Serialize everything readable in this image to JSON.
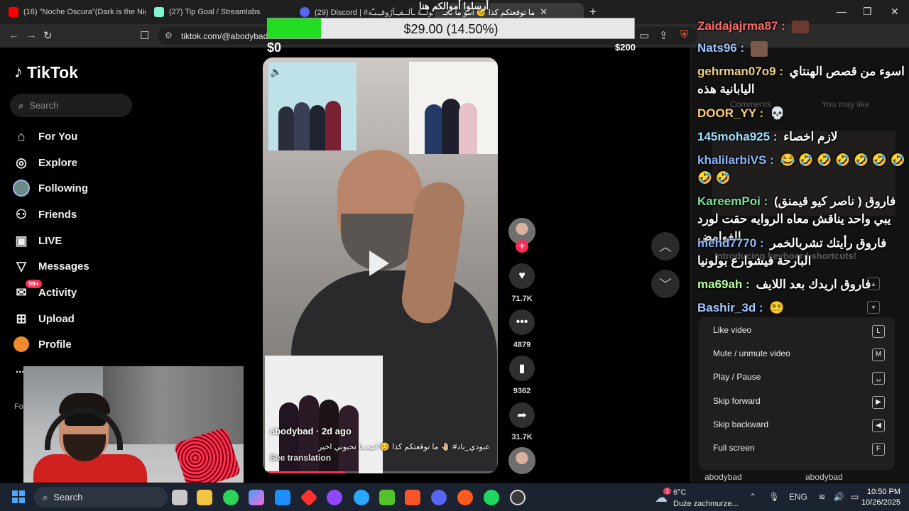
{
  "browser": {
    "tabs": [
      {
        "title": "(16) \"Noche Oscura\"(Dark is the Nigh",
        "favicon_color": "#ff0000"
      },
      {
        "title": "(27) Tip Goal / Streamlabs",
        "favicon_color": "#80f5d2"
      },
      {
        "title": "(29) Discord | #ـقـُولــهٌ ـآلــفـِـآرُوقـِـيـّة",
        "favicon_color": "#5865f2"
      },
      {
        "title": "ما توقعتكم كذا 😊 انتو ما تحـ",
        "favicon_color": "#000000",
        "active": true
      }
    ],
    "url": "tiktok.com/@abodybad"
  },
  "tip_goal": {
    "goal_title": "أرسلوا أموالكم هنا",
    "amount_text": "$29.00 (14.50%)",
    "percent": 14.5,
    "min_label": "$0",
    "max_label": "$200",
    "fill_color": "#22dd22"
  },
  "tiktok": {
    "brand": "TikTok",
    "search_placeholder": "Search",
    "nav": [
      {
        "label": "For You",
        "icon": "home-icon"
      },
      {
        "label": "Explore",
        "icon": "compass-icon"
      },
      {
        "label": "Following",
        "icon": "following-avatar-icon"
      },
      {
        "label": "Friends",
        "icon": "friends-icon"
      },
      {
        "label": "LIVE",
        "icon": "live-icon"
      },
      {
        "label": "Messages",
        "icon": "messages-icon"
      },
      {
        "label": "Activity",
        "icon": "activity-icon",
        "badge": "99+"
      },
      {
        "label": "Upload",
        "icon": "upload-icon"
      },
      {
        "label": "Profile",
        "icon": "profile-icon"
      }
    ],
    "more_label": "...",
    "fo_label": "Fo",
    "accent": "#fe2c55"
  },
  "video": {
    "author_line": "abodybad · 2d ago",
    "caption": "عبودي_باد# 🤚🏼 ما توقعتكم كذا 😊 انتو ما تحبوني اخير",
    "see_translation": "See translation",
    "progress": 0.35
  },
  "actions": {
    "likes": "71.7K",
    "comments": "4879",
    "bookmarks": "9362",
    "shares": "31.7K"
  },
  "panel": {
    "comments_tab": "Comments",
    "you_may_like_tab": "You may like",
    "shortcuts_title": "Introducing keyboard shortcuts!",
    "shortcuts": [
      {
        "label": "Like video",
        "key": "L"
      },
      {
        "label": "Mute / unmute video",
        "key": "M"
      },
      {
        "label": "Play / Pause",
        "key": "␣"
      },
      {
        "label": "Skip forward",
        "key": "▶"
      },
      {
        "label": "Skip backward",
        "key": "◀"
      },
      {
        "label": "Full screen",
        "key": "F"
      }
    ],
    "authors": [
      "abodybad",
      "abodybad"
    ]
  },
  "chat": [
    {
      "user": "Zaidajajrma87 :",
      "message": "",
      "color": "#ff6b6b"
    },
    {
      "user": "Nats96 :",
      "message": "",
      "color": "#9fc8ff"
    },
    {
      "user": "gehrman07o9 :",
      "message": "اسوء من قصص الهنتاي اليابانية هذه",
      "color": "#f0d28a"
    },
    {
      "user": "DOOR_YY :",
      "message": "💀",
      "color": "#ffd27a"
    },
    {
      "user": "145moha925 :",
      "message": "لازم اخصاء",
      "color": "#9fe0ff"
    },
    {
      "user": "khalilarbiVS :",
      "message": "😂 🤣 🤣 🤣 🤣 🤣 🤣 🤣 🤣",
      "color": "#8fb8ff"
    },
    {
      "user": "KareemPoi :",
      "message": "فاروق ( ناصر كيو قيمنق) يبي واحد يناقش معاه الروايه حقت لورد الغوامض",
      "color": "#7fe39b"
    },
    {
      "user": "mehd7770 :",
      "message": "فاروق رأيتك تشربالخمر البارحة فيشوارع بولونيا",
      "color": "#8fb8ff"
    },
    {
      "user": "ma69ah :",
      "message": "فاروق اريدك بعد اللايف",
      "color": "#b9ff9f"
    },
    {
      "user": "Bashir_3d :",
      "message": "😵‍💫",
      "color": "#a8c8ff"
    }
  ],
  "taskbar": {
    "search_placeholder": "Search",
    "weather_temp": "6°C",
    "weather_desc": "Duże zachmurze...",
    "weather_badge": "1",
    "lang": "ENG",
    "time": "10:50 PM",
    "date": "10/26/2025"
  }
}
